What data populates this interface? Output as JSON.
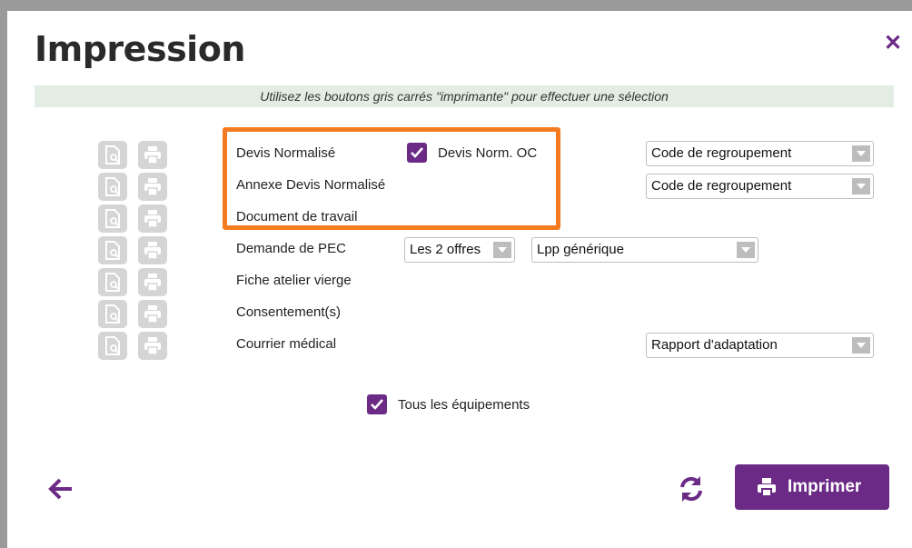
{
  "dialog": {
    "title": "Impression",
    "hint": "Utilisez les boutons gris carrés \"imprimante\" pour effectuer une sélection"
  },
  "rows": [
    {
      "label": "Devis Normalisé"
    },
    {
      "label": "Annexe Devis Normalisé"
    },
    {
      "label": "Document de travail"
    },
    {
      "label": "Demande de PEC"
    },
    {
      "label": "Fiche atelier vierge"
    },
    {
      "label": "Consentement(s)"
    },
    {
      "label": "Courrier médical"
    }
  ],
  "devis_norm_oc": {
    "label": "Devis Norm. OC",
    "checked": true
  },
  "selects": {
    "devis_grouping": "Code de regroupement",
    "annexe_grouping": "Code de regroupement",
    "pec_offers": "Les 2 offres",
    "pec_lpp": "Lpp générique",
    "courrier_type": "Rapport d'adaptation"
  },
  "all_equipment": {
    "label": "Tous les équipements",
    "checked": true
  },
  "footer": {
    "print_label": "Imprimer"
  },
  "icons": {
    "close": "close-icon",
    "preview": "document-preview-icon",
    "printer": "printer-icon",
    "back": "arrow-left-icon",
    "refresh": "refresh-icon"
  },
  "colors": {
    "accent": "#6b2a86",
    "highlight": "#f47b20",
    "hint_bg": "#e3ede3",
    "icon_bg": "#d5d5d5"
  }
}
